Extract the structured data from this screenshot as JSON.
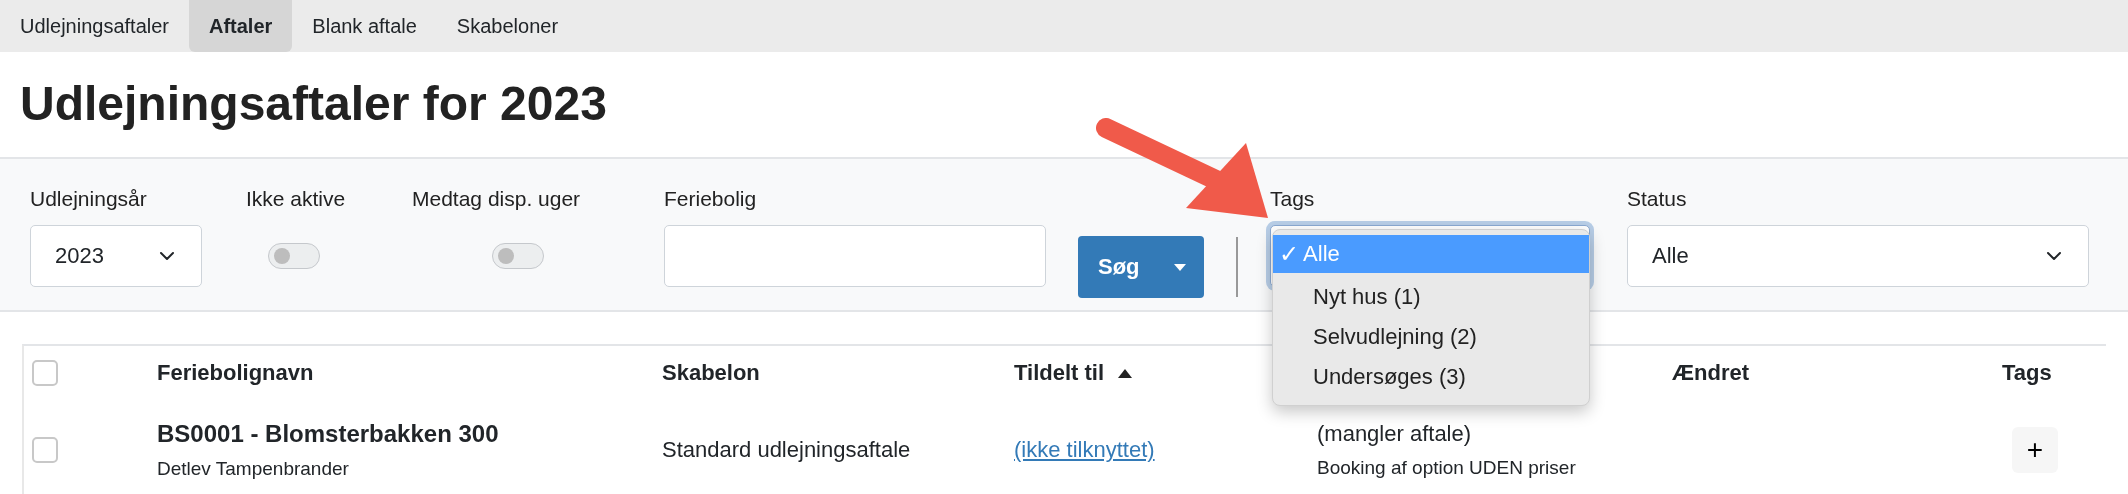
{
  "tabs": [
    {
      "label": "Udlejningsaftaler",
      "selected": false
    },
    {
      "label": "Aftaler",
      "selected": true
    },
    {
      "label": "Blank aftale",
      "selected": false
    },
    {
      "label": "Skabeloner",
      "selected": false
    }
  ],
  "page_title": "Udlejningsaftaler for 2023",
  "filters": {
    "year": {
      "label": "Udlejningsår",
      "value": "2023"
    },
    "inactive": {
      "label": "Ikke aktive",
      "on": false
    },
    "include_weeks": {
      "label": "Medtag disp. uger",
      "on": false
    },
    "property": {
      "label": "Feriebolig"
    },
    "search_button": "Søg",
    "tags": {
      "label": "Tags",
      "expanded": true,
      "check_mark": "✓",
      "options": [
        {
          "label": "Alle",
          "selected": true
        },
        {
          "label": "Nyt hus (1)",
          "selected": false
        },
        {
          "label": "Selvudlejning (2)",
          "selected": false
        },
        {
          "label": "Undersøges (3)",
          "selected": false
        }
      ]
    },
    "status": {
      "label": "Status",
      "value": "Alle"
    }
  },
  "table": {
    "all_checked": false,
    "columns": [
      {
        "label": "Feriebolignavn",
        "sorted_ascending": false
      },
      {
        "label": "Skabelon",
        "sorted_ascending": false
      },
      {
        "label": "Tildelt til",
        "sorted_ascending": true
      },
      {
        "label": "Ændret",
        "sorted_ascending": false
      },
      {
        "label": "Tags",
        "sorted_ascending": false
      }
    ],
    "rows": [
      {
        "checked": false,
        "name": "BS0001 - Blomsterbakken 300",
        "owner": "Detlev Tampenbrander",
        "template": "Standard udlejningsaftale",
        "assigned": "(ikke tilknyttet)",
        "status": "(mangler aftale)",
        "status_note": "Booking af option UDEN priser",
        "tags_button": "+"
      }
    ]
  }
}
